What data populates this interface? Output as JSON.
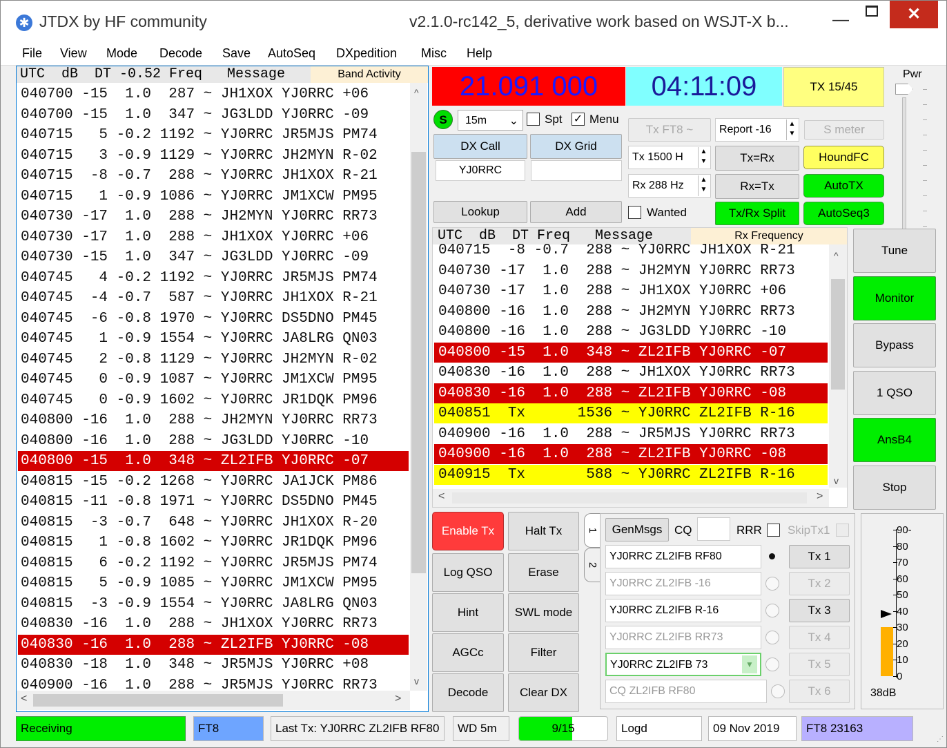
{
  "window": {
    "title": "JTDX  by HF community",
    "version": "v2.1.0-rc142_5, derivative work based on WSJT-X b...",
    "minimize": "—",
    "close": "✕"
  },
  "menu": [
    "File",
    "View",
    "Mode",
    "Decode",
    "Save",
    "AutoSeq",
    "DXpedition",
    "Misc",
    "Help"
  ],
  "band_activity": {
    "header": "UTC  dB  DT -0.52 Freq   Message",
    "tag": "Band Activity",
    "rows": [
      {
        "t": "040700 -15  1.0  287 ~ JH1XOX YJ0RRC +06",
        "hl": ""
      },
      {
        "t": "040700 -15  1.0  347 ~ JG3LDD YJ0RRC -09",
        "hl": ""
      },
      {
        "t": "040715   5 -0.2 1192 ~ YJ0RRC JR5MJS PM74",
        "hl": ""
      },
      {
        "t": "040715   3 -0.9 1129 ~ YJ0RRC JH2MYN R-02",
        "hl": ""
      },
      {
        "t": "040715  -8 -0.7  288 ~ YJ0RRC JH1XOX R-21",
        "hl": ""
      },
      {
        "t": "040715   1 -0.9 1086 ~ YJ0RRC JM1XCW PM95",
        "hl": ""
      },
      {
        "t": "040730 -17  1.0  288 ~ JH2MYN YJ0RRC RR73",
        "hl": ""
      },
      {
        "t": "040730 -17  1.0  288 ~ JH1XOX YJ0RRC +06",
        "hl": ""
      },
      {
        "t": "040730 -15  1.0  347 ~ JG3LDD YJ0RRC -09",
        "hl": ""
      },
      {
        "t": "040745   4 -0.2 1192 ~ YJ0RRC JR5MJS PM74",
        "hl": ""
      },
      {
        "t": "040745  -4 -0.7  587 ~ YJ0RRC JH1XOX R-21",
        "hl": ""
      },
      {
        "t": "040745  -6 -0.8 1970 ~ YJ0RRC DS5DNO PM45",
        "hl": ""
      },
      {
        "t": "040745   1 -0.9 1554 ~ YJ0RRC JA8LRG QN03",
        "hl": ""
      },
      {
        "t": "040745   2 -0.8 1129 ~ YJ0RRC JH2MYN R-02",
        "hl": ""
      },
      {
        "t": "040745   0 -0.9 1087 ~ YJ0RRC JM1XCW PM95",
        "hl": ""
      },
      {
        "t": "040745   0 -0.9 1602 ~ YJ0RRC JR1DQK PM96",
        "hl": ""
      },
      {
        "t": "040800 -16  1.0  288 ~ JH2MYN YJ0RRC RR73",
        "hl": ""
      },
      {
        "t": "040800 -16  1.0  288 ~ JG3LDD YJ0RRC -10",
        "hl": ""
      },
      {
        "t": "040800 -15  1.0  348 ~ ZL2IFB YJ0RRC -07",
        "hl": "red"
      },
      {
        "t": "040815 -15 -0.2 1268 ~ YJ0RRC JA1JCK PM86",
        "hl": ""
      },
      {
        "t": "040815 -11 -0.8 1971 ~ YJ0RRC DS5DNO PM45",
        "hl": ""
      },
      {
        "t": "040815  -3 -0.7  648 ~ YJ0RRC JH1XOX R-20",
        "hl": ""
      },
      {
        "t": "040815   1 -0.8 1602 ~ YJ0RRC JR1DQK PM96",
        "hl": ""
      },
      {
        "t": "040815   6 -0.2 1192 ~ YJ0RRC JR5MJS PM74",
        "hl": ""
      },
      {
        "t": "040815   5 -0.9 1085 ~ YJ0RRC JM1XCW PM95",
        "hl": ""
      },
      {
        "t": "040815  -3 -0.9 1554 ~ YJ0RRC JA8LRG QN03",
        "hl": ""
      },
      {
        "t": "040830 -16  1.0  288 ~ JH1XOX YJ0RRC RR73",
        "hl": ""
      },
      {
        "t": "040830 -16  1.0  288 ~ ZL2IFB YJ0RRC -08",
        "hl": "red"
      },
      {
        "t": "040830 -18  1.0  348 ~ JR5MJS YJ0RRC +08",
        "hl": ""
      },
      {
        "t": "040900 -16  1.0  288 ~ JR5MJS YJ0RRC RR73",
        "hl": ""
      }
    ]
  },
  "rx_frequency": {
    "header": "UTC  dB  DT Freq   Message",
    "tag": "Rx Frequency",
    "rows": [
      {
        "t": "040715  -8 -0.7  288 ~ YJ0RRC JH1XOX R-21",
        "hl": ""
      },
      {
        "t": "040730 -17  1.0  288 ~ JH2MYN YJ0RRC RR73",
        "hl": ""
      },
      {
        "t": "040730 -17  1.0  288 ~ JH1XOX YJ0RRC +06",
        "hl": ""
      },
      {
        "t": "040800 -16  1.0  288 ~ JH2MYN YJ0RRC RR73",
        "hl": ""
      },
      {
        "t": "040800 -16  1.0  288 ~ JG3LDD YJ0RRC -10",
        "hl": ""
      },
      {
        "t": "040800 -15  1.0  348 ~ ZL2IFB YJ0RRC -07",
        "hl": "red"
      },
      {
        "t": "040830 -16  1.0  288 ~ JH1XOX YJ0RRC RR73",
        "hl": ""
      },
      {
        "t": "040830 -16  1.0  288 ~ ZL2IFB YJ0RRC -08",
        "hl": "red"
      },
      {
        "t": "040851  Tx      1536 ~ YJ0RRC ZL2IFB R-16",
        "hl": "yellow"
      },
      {
        "t": "040900 -16  1.0  288 ~ JR5MJS YJ0RRC RR73",
        "hl": ""
      },
      {
        "t": "040900 -16  1.0  288 ~ ZL2IFB YJ0RRC -08",
        "hl": "red"
      },
      {
        "t": "040915  Tx       588 ~ YJ0RRC ZL2IFB R-16",
        "hl": "yellow"
      }
    ]
  },
  "freq_display": "21.091 000",
  "clock": "04:11:09",
  "tx_period": "TX 15/45",
  "pwr_label": "Pwr",
  "band": {
    "s_label": "S",
    "value": "15m",
    "spt": "Spt",
    "menu": "Menu"
  },
  "dx": {
    "call_label": "DX Call",
    "grid_label": "DX Grid",
    "call": "YJ0RRC",
    "grid": "",
    "lookup": "Lookup",
    "add": "Add",
    "wanted": "Wanted"
  },
  "txft8": "Tx FT8 ~",
  "report": "Report -16",
  "smeter": "S meter",
  "tx_freq": "Tx  1500 H",
  "rx_freq": "Rx  288 Hz",
  "txrx_eq": "Tx=Rx",
  "rxtx_eq": "Rx=Tx",
  "txrx_split": "Tx/Rx Split",
  "houndfc": "HoundFC",
  "autotx": "AutoTX",
  "autoseq3": "AutoSeq3",
  "right_buttons": [
    "Tune",
    "Monitor",
    "Bypass",
    "1 QSO",
    "AnsB4",
    "Stop"
  ],
  "bottom_buttons": {
    "enable_tx": "Enable Tx",
    "halt_tx": "Halt Tx",
    "log_qso": "Log QSO",
    "erase": "Erase",
    "hint": "Hint",
    "swl_mode": "SWL mode",
    "agcc": "AGCc",
    "filter": "Filter",
    "decode": "Decode",
    "clear_dx": "Clear DX"
  },
  "tabs": [
    "1",
    "2"
  ],
  "genmsgs": {
    "gen": "GenMsgs",
    "cq": "CQ",
    "rrr": "RRR",
    "skip": "SkipTx1"
  },
  "tx_messages": [
    {
      "msg": "YJ0RRC ZL2IFB RF80",
      "btn": "Tx 1"
    },
    {
      "msg": "YJ0RRC ZL2IFB -16",
      "btn": "Tx 2"
    },
    {
      "msg": "YJ0RRC ZL2IFB R-16",
      "btn": "Tx 3"
    },
    {
      "msg": "YJ0RRC ZL2IFB RR73",
      "btn": "Tx 4"
    },
    {
      "msg": "YJ0RRC ZL2IFB 73",
      "btn": "Tx 5"
    },
    {
      "msg": "CQ ZL2IFB RF80",
      "btn": "Tx 6"
    }
  ],
  "meter": {
    "labels": [
      "90-",
      "80",
      "70",
      "60",
      "50",
      "40",
      "30",
      "20",
      "10",
      "0"
    ],
    "level_db": 38,
    "reading": "38dB"
  },
  "status": {
    "state": "Receiving",
    "mode": "FT8",
    "last_tx": "Last Tx: YJ0RRC ZL2IFB RF80",
    "wd": "WD 5m",
    "progress": "9/15",
    "progress_fraction": 0.6,
    "logd": "Logd",
    "date": "09 Nov 2019",
    "ft8_count": "FT8  23163"
  },
  "colors": {
    "red_hl": "#d40000",
    "yellow_hl": "#ffff00",
    "green_btn": "#00ee00",
    "freq_bg": "#ff0000",
    "freq_fg": "#1a1aff",
    "clock_bg": "#80ffff",
    "tx_bg": "#ffff80"
  }
}
